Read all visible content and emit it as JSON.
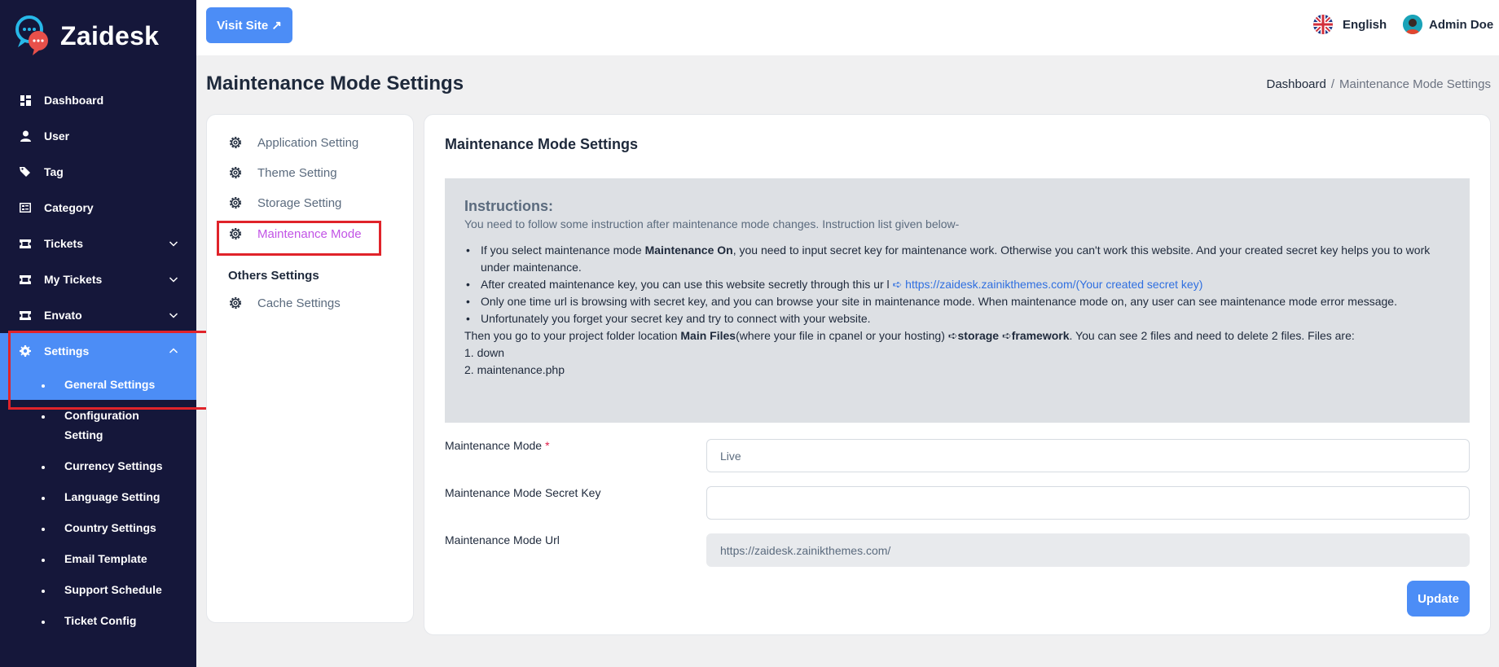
{
  "brand": {
    "name": "Zaidesk"
  },
  "sidebar": {
    "items": [
      {
        "label": "Dashboard",
        "icon": "dashboard-icon"
      },
      {
        "label": "User",
        "icon": "user-icon"
      },
      {
        "label": "Tag",
        "icon": "tag-icon"
      },
      {
        "label": "Category",
        "icon": "category-icon"
      },
      {
        "label": "Tickets",
        "icon": "ticket-icon"
      },
      {
        "label": "My Tickets",
        "icon": "ticket-icon"
      },
      {
        "label": "Envato",
        "icon": "envato-icon"
      },
      {
        "label": "Settings",
        "icon": "gear-icon"
      }
    ],
    "sub_items": [
      "General Settings",
      "Configuration Setting",
      "Currency Settings",
      "Language Setting",
      "Country Settings",
      "Email Template",
      "Support Schedule",
      "Ticket Config"
    ]
  },
  "topbar": {
    "visit_site": "Visit Site ↗",
    "language": "English",
    "user_name": "Admin Doe"
  },
  "page": {
    "title": "Maintenance Mode Settings",
    "breadcrumb_home": "Dashboard",
    "breadcrumb_sep": "/",
    "breadcrumb_current": "Maintenance Mode Settings"
  },
  "settings_menu": {
    "items": [
      "Application Setting",
      "Theme Setting",
      "Storage Setting",
      "Maintenance Mode"
    ],
    "others_heading": "Others Settings",
    "others_items": [
      "Cache Settings"
    ]
  },
  "main": {
    "title": "Maintenance Mode Settings",
    "instructions": {
      "heading": "Instructions:",
      "subheading": "You need to follow some instruction after maintenance mode changes. Instruction list given below-",
      "b1_pre": "If you select maintenance mode ",
      "b1_bold": "Maintenance On",
      "b1_post": ", you need to input secret key for maintenance work. Otherwise you can't work this website. And your created secret key helps you to work under maintenance.",
      "b2_pre": "After created maintenance key, you can use this website secretly through this ur l ",
      "b2_link": "➪ https://zaidesk.zainikthemes.com/(Your created secret key)",
      "b3": "Only one time url is browsing with secret key, and you can browse your site in maintenance mode. When maintenance mode on, any user can see maintenance mode error message.",
      "b4": "Unfortunately you forget your secret key and try to connect with your website.",
      "p_pre": "Then you go to your project folder location ",
      "p_bold1": "Main Files",
      "p_mid": "(where your file in cpanel or your hosting) ➪",
      "p_bold2": "storage",
      "p_arrow": " ➪",
      "p_bold3": "framework",
      "p_post": ". You can see 2 files and need to delete 2 files. Files are:",
      "file1": "1. down",
      "file2": "2. maintenance.php"
    },
    "fields": {
      "mode_label": "Maintenance Mode",
      "mode_required": "*",
      "mode_value": "Live",
      "key_label": "Maintenance Mode Secret Key",
      "key_value": "",
      "url_label": "Maintenance Mode Url",
      "url_value": "https://zaidesk.zainikthemes.com/"
    },
    "update_label": "Update"
  },
  "colors": {
    "sidebar_bg": "#15173a",
    "accent": "#4c8df6",
    "active_menu": "#c254e6",
    "highlight": "#e0232a"
  }
}
